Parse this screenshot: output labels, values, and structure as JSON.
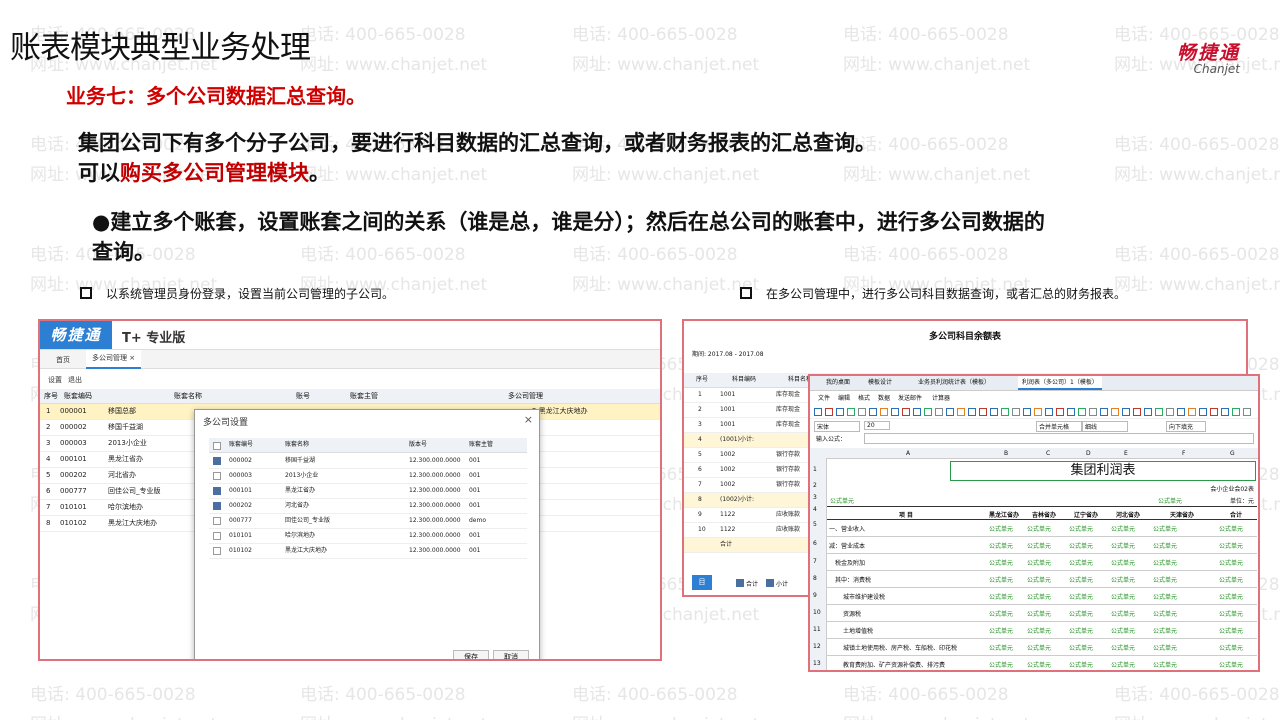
{
  "watermark": {
    "phone": "电话: 400-665-0028",
    "site": "网址: www.chanjet.net"
  },
  "slide": {
    "title": "账表模块典型业务处理",
    "subtitle": "业务七：多个公司数据汇总查询。",
    "para_line1": "集团公司下有多个分子公司，要进行科目数据的汇总查询，或者财务报表的汇总查询。",
    "para_line2_prefix": "可以",
    "para_line2_red": "购买多公司管理模块",
    "para_line2_suffix": "。",
    "bullet_line1": "●建立多个账套，设置账套之间的关系（谁是总，谁是分）；然后在总公司的账套中，进行多公司数据的",
    "bullet_line2": "查询。",
    "note_left": "以系统管理员身份登录，设置当前公司管理的子公司。",
    "note_right": "在多公司管理中，进行多公司科目数据查询，或者汇总的财务报表。"
  },
  "logo": {
    "cn": "畅捷通",
    "en": "Chanjet"
  },
  "left_app": {
    "brand": "畅捷通",
    "edition": "T+ 专业版",
    "tabs": [
      "首页",
      "多公司管理"
    ],
    "toolbar": [
      "设置",
      "退出"
    ],
    "columns": [
      "序号",
      "账套编码",
      "账套名称",
      "账号",
      "账套主管",
      "多公司管理"
    ],
    "rows": [
      {
        "no": "1",
        "code": "000001",
        "name": "移国总部"
      },
      {
        "no": "2",
        "code": "000002",
        "name": "移国千益湖"
      },
      {
        "no": "3",
        "code": "000003",
        "name": "2013小企业"
      },
      {
        "no": "4",
        "code": "000101",
        "name": "黑龙江省办"
      },
      {
        "no": "5",
        "code": "000202",
        "name": "河北省办"
      },
      {
        "no": "6",
        "code": "000777",
        "name": "回佳公司_专业版"
      },
      {
        "no": "7",
        "code": "010101",
        "name": "哈尔滨地办"
      },
      {
        "no": "8",
        "code": "010102",
        "name": "黑龙江大庆地办"
      }
    ],
    "row1_extra": "2 黑龙江大庆地办",
    "dialog": {
      "title": "多公司设置",
      "columns": [
        "账套编号",
        "账套名称",
        "版本号",
        "账套主管"
      ],
      "rows": [
        {
          "checked": true,
          "code": "000002",
          "name": "移国千益湖",
          "ver": "12.300.000.0000",
          "mgr": "001"
        },
        {
          "checked": false,
          "code": "000003",
          "name": "2013小企业",
          "ver": "12.300.000.0000",
          "mgr": "001"
        },
        {
          "checked": true,
          "code": "000101",
          "name": "黑龙江省办",
          "ver": "12.300.000.0000",
          "mgr": "001"
        },
        {
          "checked": true,
          "code": "000202",
          "name": "河北省办",
          "ver": "12.300.000.0000",
          "mgr": "001"
        },
        {
          "checked": false,
          "code": "000777",
          "name": "回佳公司_专业版",
          "ver": "12.300.000.0000",
          "mgr": "demo"
        },
        {
          "checked": false,
          "code": "010101",
          "name": "哈尔滨地办",
          "ver": "12.300.000.0000",
          "mgr": "001"
        },
        {
          "checked": false,
          "code": "010102",
          "name": "黑龙江大庆地办",
          "ver": "12.300.000.0000",
          "mgr": "001"
        }
      ],
      "save": "保存",
      "cancel": "取消"
    }
  },
  "right_back": {
    "title": "多公司科目余额表",
    "period": "期间: 2017.08 - 2017.08",
    "columns": [
      "序号",
      "科目编码",
      "科目名称"
    ],
    "rows": [
      {
        "no": "1",
        "code": "1001",
        "name": "库存现金"
      },
      {
        "no": "2",
        "code": "1001",
        "name": "库存现金"
      },
      {
        "no": "3",
        "code": "1001",
        "name": "库存现金"
      },
      {
        "no": "4",
        "code": "(1001)小计:",
        "name": ""
      },
      {
        "no": "5",
        "code": "1002",
        "name": "银行存款"
      },
      {
        "no": "6",
        "code": "1002",
        "name": "银行存款"
      },
      {
        "no": "7",
        "code": "1002",
        "name": "银行存款"
      },
      {
        "no": "8",
        "code": "(1002)小计:",
        "name": ""
      },
      {
        "no": "9",
        "code": "1122",
        "name": "应收账款"
      },
      {
        "no": "10",
        "code": "1122",
        "name": "应收账款"
      },
      {
        "no": "",
        "code": "合计",
        "name": ""
      }
    ],
    "btn": "目",
    "check1": "合计",
    "check2": "小计"
  },
  "right_front": {
    "tabs": [
      "我的桌面",
      "模板设计",
      "业务员利润统计表（模板）",
      "利润表（多公司）1（模板）"
    ],
    "menu": [
      "文件",
      "编辑",
      "格式",
      "数据",
      "发送邮件",
      "计算器"
    ],
    "font": "宋体",
    "size": "20",
    "merge": "合并单元格",
    "border": "细线",
    "fill": "向下填充",
    "formula_label": "输入公式：",
    "col_letters": [
      "A",
      "B",
      "C",
      "D",
      "E",
      "F",
      "G"
    ],
    "sheet_title": "集团利润表",
    "top_right_1": "会小企业会02表",
    "unit_label": "单位：元",
    "formula_cell": "公式单元",
    "headers": [
      "项  目",
      "黑龙江省办",
      "吉林省办",
      "辽宁省办",
      "河北省办",
      "天津省办",
      "合计"
    ],
    "items": [
      "一、营业收入",
      "减：营业成本",
      "税金及附加",
      "其中：消费税",
      "城市维护建设税",
      "资源税",
      "土地增值税",
      "城镇土地使用税、房产税、车船税、印花税",
      "教育费附加、矿产资源补偿费、排污费",
      "销售费用"
    ],
    "row_nums": [
      "1",
      "2",
      "3",
      "4",
      "5",
      "6",
      "7",
      "8",
      "9",
      "10",
      "11",
      "12",
      "13",
      "14"
    ]
  }
}
